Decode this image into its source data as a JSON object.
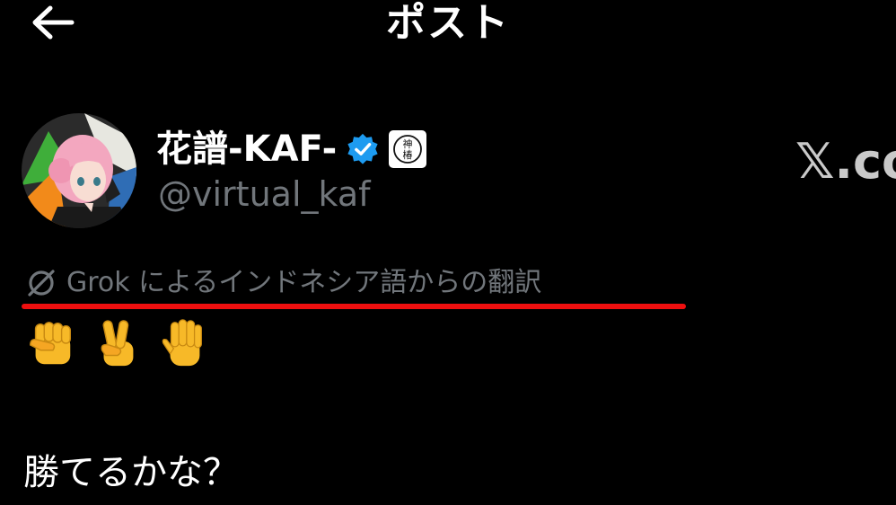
{
  "header": {
    "title": "ポスト",
    "back_icon": "arrow-left-icon"
  },
  "author": {
    "display_name": "花譜-KAF-",
    "handle": "@virtual_kaf",
    "verified_icon": "verified-badge-icon",
    "badge_icon": "kamitsubaki-badge-icon",
    "badge_text": "神椿"
  },
  "translation": {
    "label": "Grok によるインドネシア語からの翻訳",
    "icon": "grok-icon"
  },
  "post": {
    "emojis": [
      "raised-fist-emoji",
      "victory-hand-emoji",
      "raised-hand-emoji"
    ],
    "text": "勝てるかな？"
  },
  "watermark": {
    "text": "𝕏.co"
  },
  "colors": {
    "background": "#000000",
    "text_primary": "#ffffff",
    "text_secondary": "#71767b",
    "verified_blue": "#1d9bf0",
    "highlight_red": "#ee0f0f",
    "watermark": "#c9c9c9"
  }
}
